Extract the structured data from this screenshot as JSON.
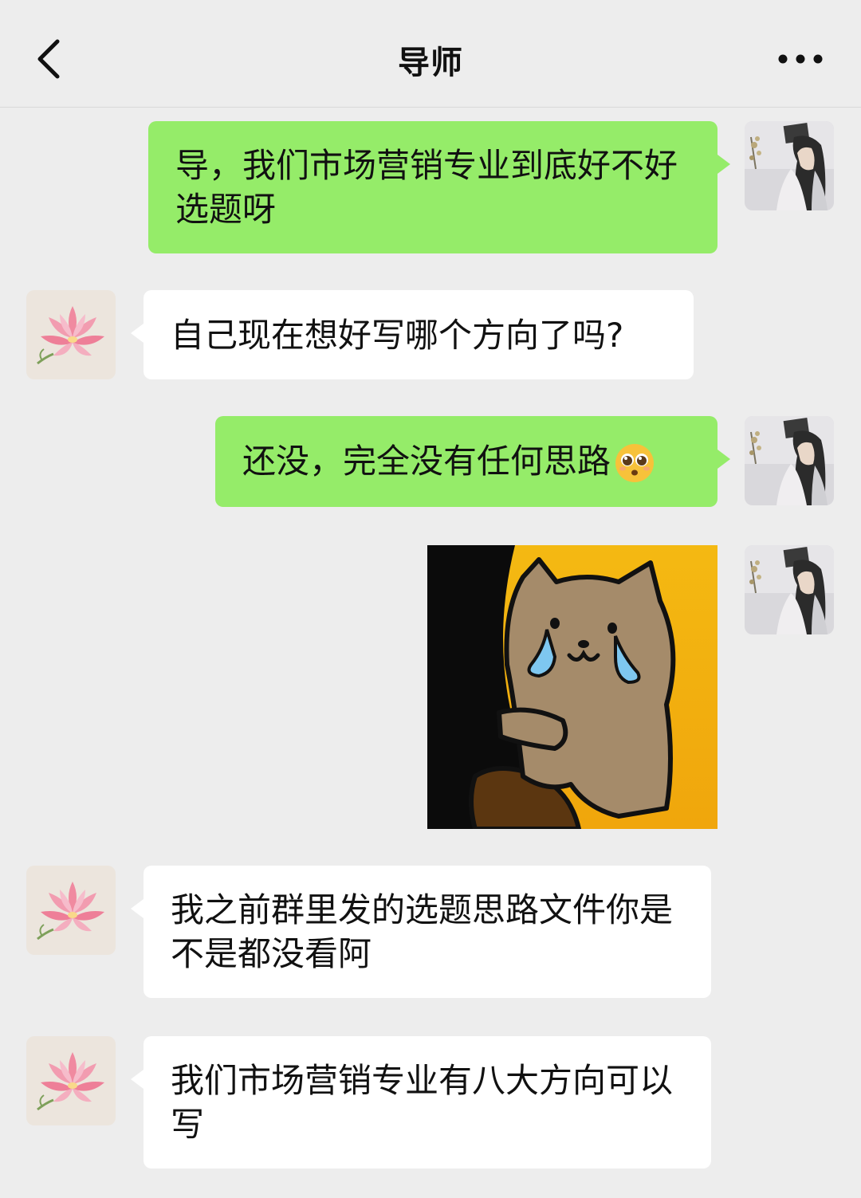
{
  "header": {
    "title": "导师",
    "back_icon": "chevron-left-icon",
    "more_icon": "more-dots-icon"
  },
  "colors": {
    "me_bubble": "#95ec69",
    "other_bubble": "#ffffff",
    "background": "#ededed"
  },
  "messages": [
    {
      "sender": "me",
      "type": "text",
      "text": "导，我们市场营销专业到底好不好选题呀"
    },
    {
      "sender": "other",
      "type": "text",
      "text": "自己现在想好写哪个方向了吗?"
    },
    {
      "sender": "me",
      "type": "text",
      "text": "还没，完全没有任何思路",
      "emoji": "pleading-face-icon"
    },
    {
      "sender": "me",
      "type": "sticker",
      "sticker": "crying-cat-hugging-leg-sticker"
    },
    {
      "sender": "other",
      "type": "text",
      "text": "我之前群里发的选题思路文件你是不是都没看阿"
    },
    {
      "sender": "other",
      "type": "text",
      "text": "我们市场营销专业有八大方向可以写"
    }
  ]
}
